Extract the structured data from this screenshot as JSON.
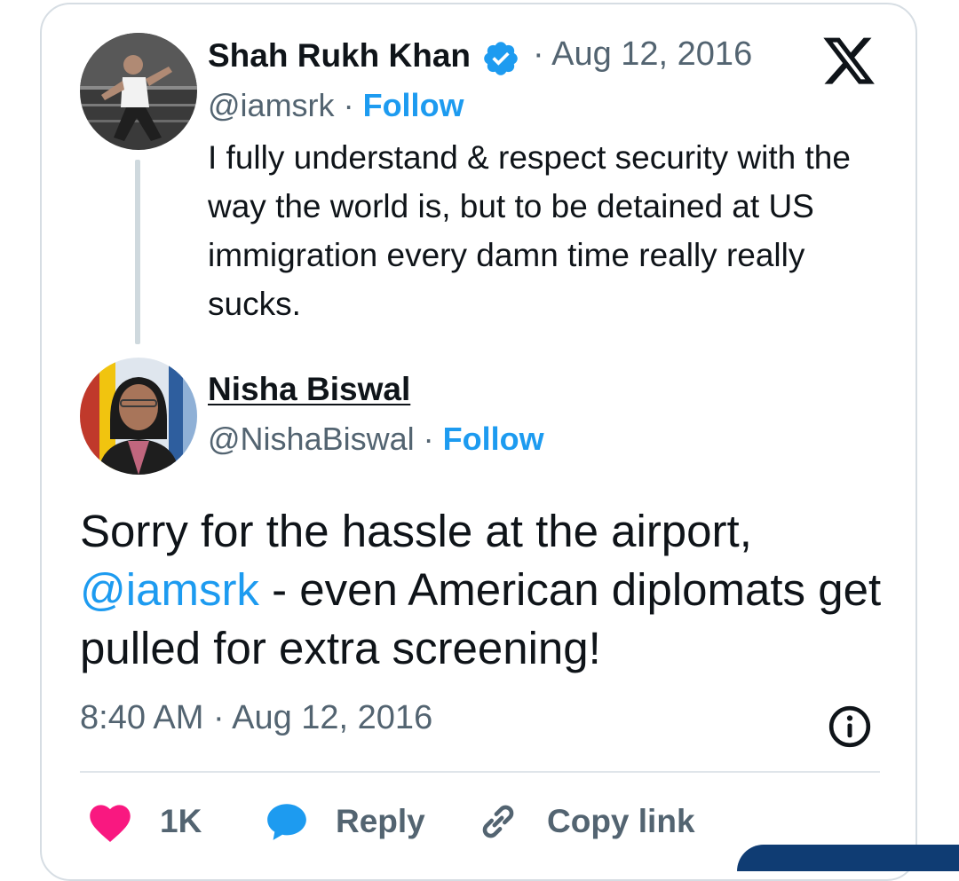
{
  "quoted_tweet": {
    "author_name": "Shah Rukh Khan",
    "date": "· Aug 12, 2016",
    "handle": "@iamsrk",
    "separator": "·",
    "follow_label": "Follow",
    "text": "I fully understand & respect security with the way the world is, but to be detained at US immigration every damn time really really sucks."
  },
  "tweet": {
    "author_name": "Nisha Biswal",
    "handle": "@NishaBiswal",
    "separator": "·",
    "follow_label": "Follow",
    "text_before": "Sorry for the hassle at the airport,",
    "mention": "@iamsrk",
    "text_after": " - even American diplomats get pulled for extra screening!",
    "time": "8:40 AM",
    "time_separator": " · ",
    "date": "Aug 12, 2016"
  },
  "actions": {
    "like_count": "1K",
    "reply_label": "Reply",
    "copy_label": "Copy link"
  },
  "icons": {
    "brand": "x-logo-icon",
    "verified": "verified-badge-icon",
    "info": "info-icon",
    "like": "heart-icon",
    "reply": "speech-bubble-icon",
    "copy": "link-icon"
  },
  "colors": {
    "accent": "#1d9bf0",
    "like": "#f91880",
    "muted": "#536471",
    "text": "#0f1419"
  }
}
